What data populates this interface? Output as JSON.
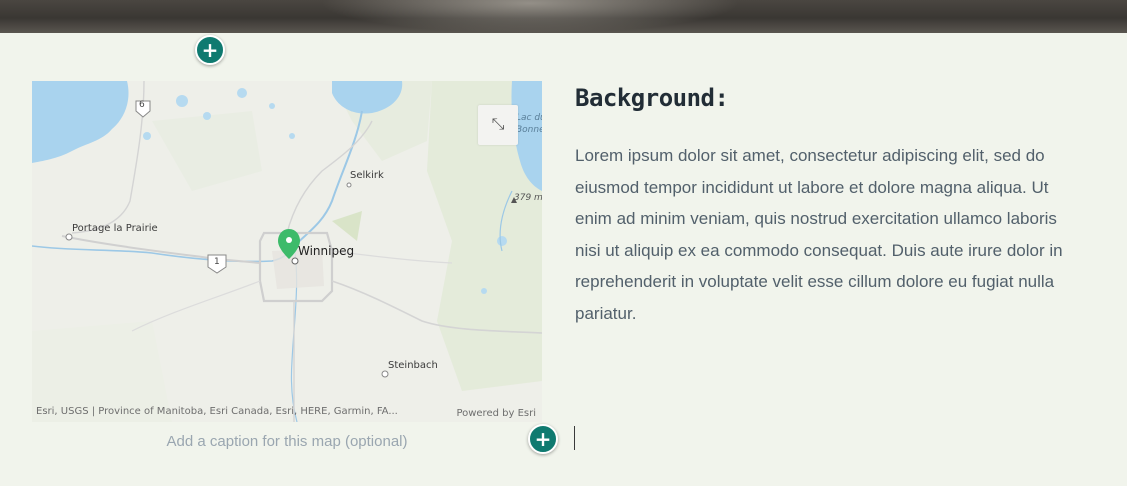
{
  "hero": {
    "label": "header image strip"
  },
  "buttons": {
    "add_symbol": "+"
  },
  "map": {
    "places": {
      "winnipeg": "Winnipeg",
      "selkirk": "Selkirk",
      "portage": "Portage la Prairie",
      "steinbach": "Steinbach",
      "lac": "Lac du",
      "bonnet": "Bonnet",
      "elev": "379 m"
    },
    "shields": {
      "hwy6": "6",
      "hwy1": "1"
    },
    "expand_icon": "⤡",
    "attribution": "Esri, USGS | Province of Manitoba, Esri Canada, Esri, HERE, Garmin, FA...",
    "powered_by": "Powered by Esri",
    "caption_placeholder": "Add a caption for this map (optional)"
  },
  "content": {
    "heading": "Background:",
    "body": "Lorem ipsum dolor sit amet, consectetur adipiscing elit, sed do eiusmod tempor incididunt ut labore et dolore magna aliqua. Ut enim ad minim veniam, quis nostrud exercitation ullamco laboris nisi ut aliquip ex ea commodo consequat. Duis aute irure dolor in reprehenderit in voluptate velit esse cillum dolore eu fugiat nulla pariatur."
  },
  "colors": {
    "page_bg": "#f1f4ec",
    "accent_teal": "#0f7a70",
    "marker_green": "#3dbb6a",
    "water": "#a9d3ee"
  }
}
